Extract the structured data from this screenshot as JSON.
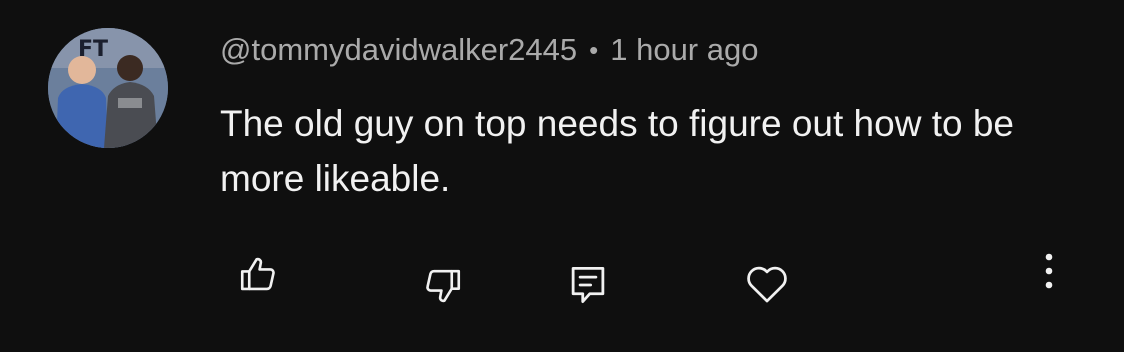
{
  "comment": {
    "author": "@tommydavidwalker2445",
    "separator": "•",
    "timestamp": "1 hour ago",
    "text": "The old guy on top needs to figure out how to be more likeable.",
    "avatar_overlay_text": "FT",
    "actions": {
      "like_icon": "thumbs-up-icon",
      "dislike_icon": "thumbs-down-icon",
      "reply_icon": "reply-icon",
      "heart_icon": "heart-icon",
      "more_icon": "more-vertical-icon"
    }
  },
  "colors": {
    "background": "#0f0f0f",
    "primary_text": "#f1f1f1",
    "secondary_text": "#aaaaaa",
    "icon": "#f1f1f1"
  }
}
